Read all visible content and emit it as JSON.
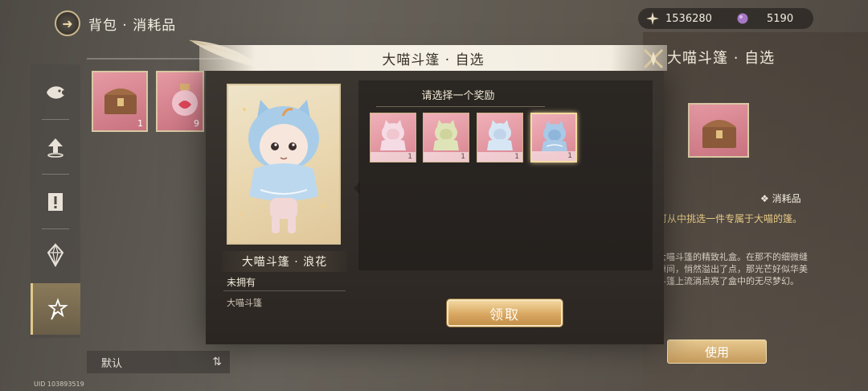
{
  "header": {
    "title": "背包 · 消耗品",
    "back_icon": "back-arrow-icon"
  },
  "currency": [
    {
      "icon": "star-sparkle-icon",
      "value": "1536280"
    },
    {
      "icon": "purple-gem-icon",
      "value": "5190"
    }
  ],
  "sidebar": {
    "items": [
      {
        "icon": "fish-icon"
      },
      {
        "icon": "upload-arrow-icon"
      },
      {
        "icon": "warning-banner-icon"
      },
      {
        "icon": "crystal-icon"
      },
      {
        "icon": "magic-wand-icon"
      }
    ],
    "active_index": 4
  },
  "inventory": [
    {
      "icon": "treasure-chest-icon",
      "count": "1"
    },
    {
      "icon": "potion-bottle-icon",
      "count": "9"
    }
  ],
  "sort": {
    "label": "默认",
    "icon": "sort-toggle-icon"
  },
  "uid": "UID 103893519",
  "detail": {
    "title": "大喵斗篷 · 自选",
    "type": "消耗品",
    "desc_highlight": "可从中挑选一件专属于大喵的篷。",
    "desc_body": "大喵斗篷的精致礼盒。在那不的细微缝隙间，悄然溢出了点，那光芒好似华美斗篷上流淌点亮了盒中的无尽梦幻。",
    "use_button": "使用"
  },
  "modal": {
    "title": "大喵斗篷 · 自选",
    "preview_name": "大喵斗篷 · 浪花",
    "own_status": "未拥有",
    "item_type": "大喵斗篷",
    "reward_heading": "请选择一个奖励",
    "rewards": [
      {
        "icon": "pink-cloak-icon",
        "count": "1",
        "color": "#f4dbe4"
      },
      {
        "icon": "yellow-cloak-icon",
        "count": "1",
        "color": "#dfe4b8"
      },
      {
        "icon": "blue-cloak-icon",
        "count": "1",
        "color": "#d7e6f4"
      },
      {
        "icon": "wave-cloak-icon",
        "count": "1",
        "color": "#a9c9e6"
      }
    ],
    "selected_index": 3,
    "claim_button": "领取"
  },
  "colors": {
    "accent_gold": "#d9a862",
    "panel_dark": "#2b2622"
  }
}
